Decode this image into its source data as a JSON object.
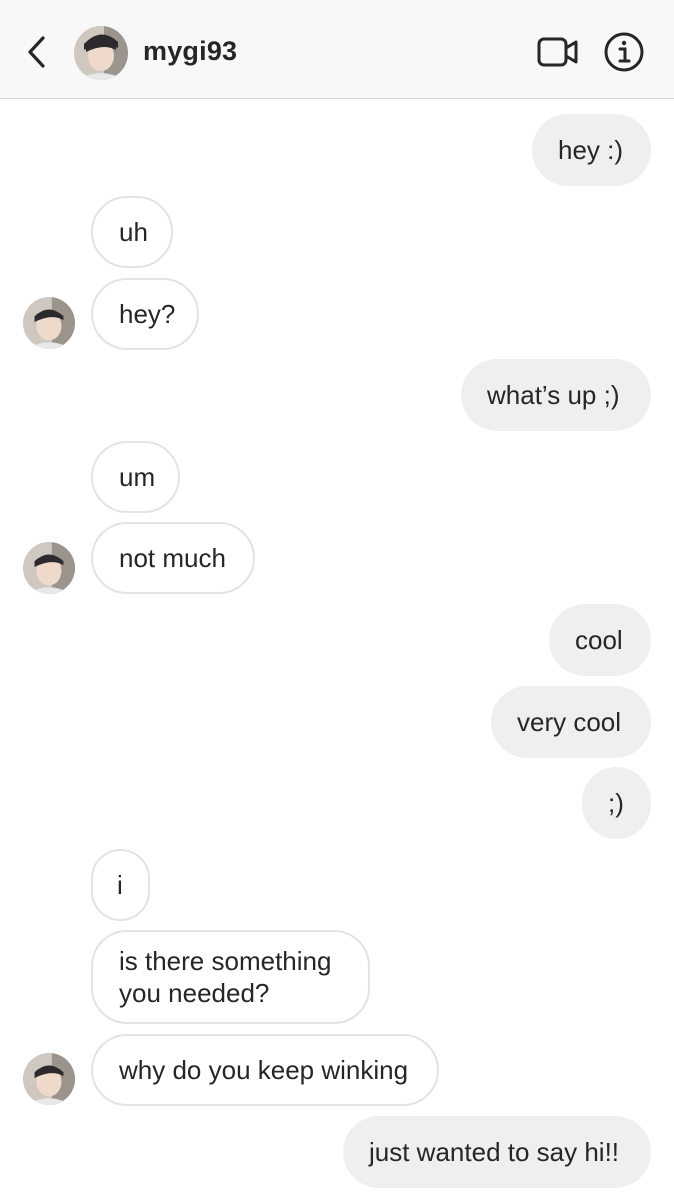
{
  "header": {
    "username": "mygi93"
  },
  "icons": {
    "back": "chevron-left-icon",
    "video": "video-camera-icon",
    "info": "info-icon"
  },
  "messages": [
    {
      "from": "me",
      "text": "hey :)"
    },
    {
      "from": "them",
      "text": "uh"
    },
    {
      "from": "them",
      "text": "hey?"
    },
    {
      "from": "me",
      "text": "what’s up ;)"
    },
    {
      "from": "them",
      "text": "um"
    },
    {
      "from": "them",
      "text": "not much"
    },
    {
      "from": "me",
      "text": "cool"
    },
    {
      "from": "me",
      "text": "very cool"
    },
    {
      "from": "me",
      "text": ";)"
    },
    {
      "from": "them",
      "text": "i"
    },
    {
      "from": "them",
      "text": "is there something you needed?"
    },
    {
      "from": "them",
      "text": "why do you keep winking"
    },
    {
      "from": "me",
      "text": "just wanted to say hi!!"
    }
  ],
  "colors": {
    "outgoing_bubble": "#efefef",
    "incoming_border": "#e3e3e3",
    "text": "#262626"
  }
}
